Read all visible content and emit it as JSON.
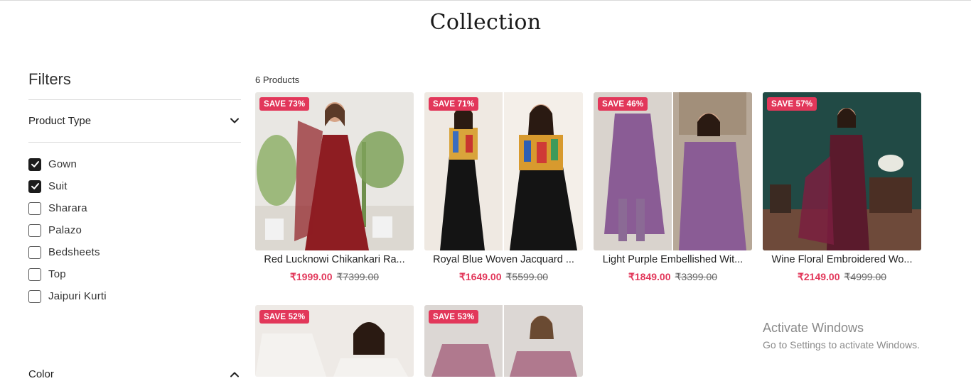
{
  "page": {
    "title": "Collection"
  },
  "filters": {
    "heading": "Filters",
    "product_type": {
      "label": "Product Type",
      "options": [
        {
          "label": "Gown",
          "checked": true
        },
        {
          "label": "Suit",
          "checked": true
        },
        {
          "label": "Sharara",
          "checked": false
        },
        {
          "label": "Palazo",
          "checked": false
        },
        {
          "label": "Bedsheets",
          "checked": false
        },
        {
          "label": "Top",
          "checked": false
        },
        {
          "label": "Jaipuri Kurti",
          "checked": false
        }
      ]
    },
    "color": {
      "label": "Color"
    }
  },
  "products": {
    "count_label": "6 Products",
    "items": [
      {
        "badge": "SAVE 73%",
        "name": "Red Lucknowi Chikankari Ra...",
        "price": "₹1999.00",
        "compare_price": "₹7399.00",
        "colors": {
          "bg": "#e9e7e3",
          "garment": "#8e1d22"
        }
      },
      {
        "badge": "SAVE 71%",
        "name": "Royal Blue Woven Jacquard ...",
        "price": "₹1649.00",
        "compare_price": "₹5599.00",
        "colors": {
          "bg": "#efe9e2",
          "garment": "#141414"
        }
      },
      {
        "badge": "SAVE 46%",
        "name": "Light Purple Embellished Wit...",
        "price": "₹1849.00",
        "compare_price": "₹3399.00",
        "colors": {
          "bg": "#d9d3cd",
          "garment": "#8a5c95"
        }
      },
      {
        "badge": "SAVE 57%",
        "name": "Wine Floral Embroidered Wo...",
        "price": "₹2149.00",
        "compare_price": "₹4999.00",
        "colors": {
          "bg": "#214a45",
          "garment": "#5a1a2c"
        }
      },
      {
        "badge": "SAVE 52%",
        "name": "",
        "price": "",
        "compare_price": "",
        "colors": {
          "bg": "#eeeae6",
          "garment": "#f4f2ef"
        }
      },
      {
        "badge": "SAVE 53%",
        "name": "",
        "price": "",
        "compare_price": "",
        "colors": {
          "bg": "#dcd7d4",
          "garment": "#b0798e"
        }
      }
    ]
  },
  "watermark": {
    "title": "Activate Windows",
    "subtitle": "Go to Settings to activate Windows."
  }
}
